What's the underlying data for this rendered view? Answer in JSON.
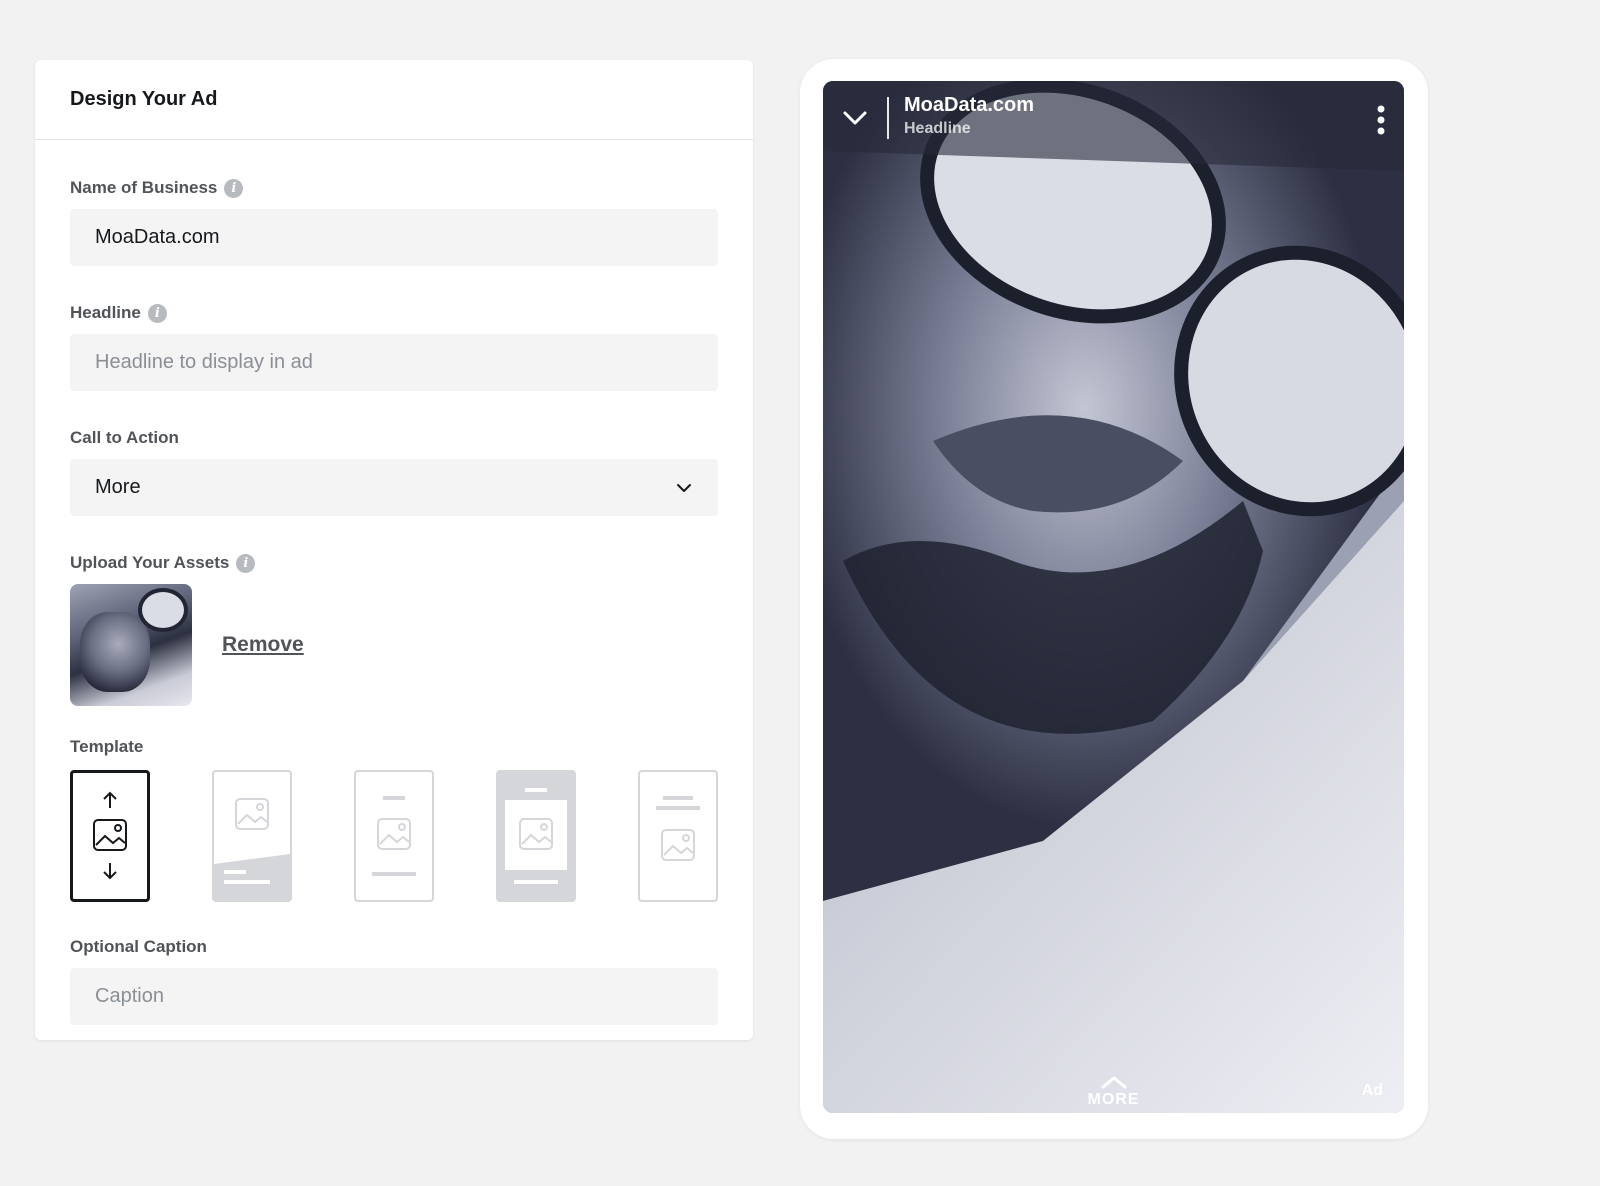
{
  "panel": {
    "title": "Design Your Ad"
  },
  "form": {
    "business_name": {
      "label": "Name of Business",
      "value": "MoaData.com"
    },
    "headline": {
      "label": "Headline",
      "placeholder": "Headline to display in ad",
      "value": ""
    },
    "cta": {
      "label": "Call to Action",
      "selected": "More"
    },
    "assets": {
      "label": "Upload Your Assets",
      "remove_label": "Remove"
    },
    "template": {
      "label": "Template",
      "options": [
        "template-1",
        "template-2",
        "template-3",
        "template-4",
        "template-5"
      ],
      "selected_index": 0
    },
    "caption": {
      "label": "Optional Caption",
      "placeholder": "Caption",
      "value": ""
    }
  },
  "preview": {
    "business_name": "MoaData.com",
    "headline": "Headline",
    "more_label": "MORE",
    "ad_label": "Ad"
  },
  "colors": {
    "background": "#f2f2f2",
    "input_bg": "#f4f4f5",
    "label": "#505459",
    "selected_border": "#16191c"
  },
  "icons": [
    "info-icon",
    "chevron-down-icon",
    "collapse-chevron-icon",
    "kebab-menu-icon",
    "chevron-up-icon",
    "image-icon",
    "arrow-up-icon",
    "arrow-down-icon"
  ]
}
